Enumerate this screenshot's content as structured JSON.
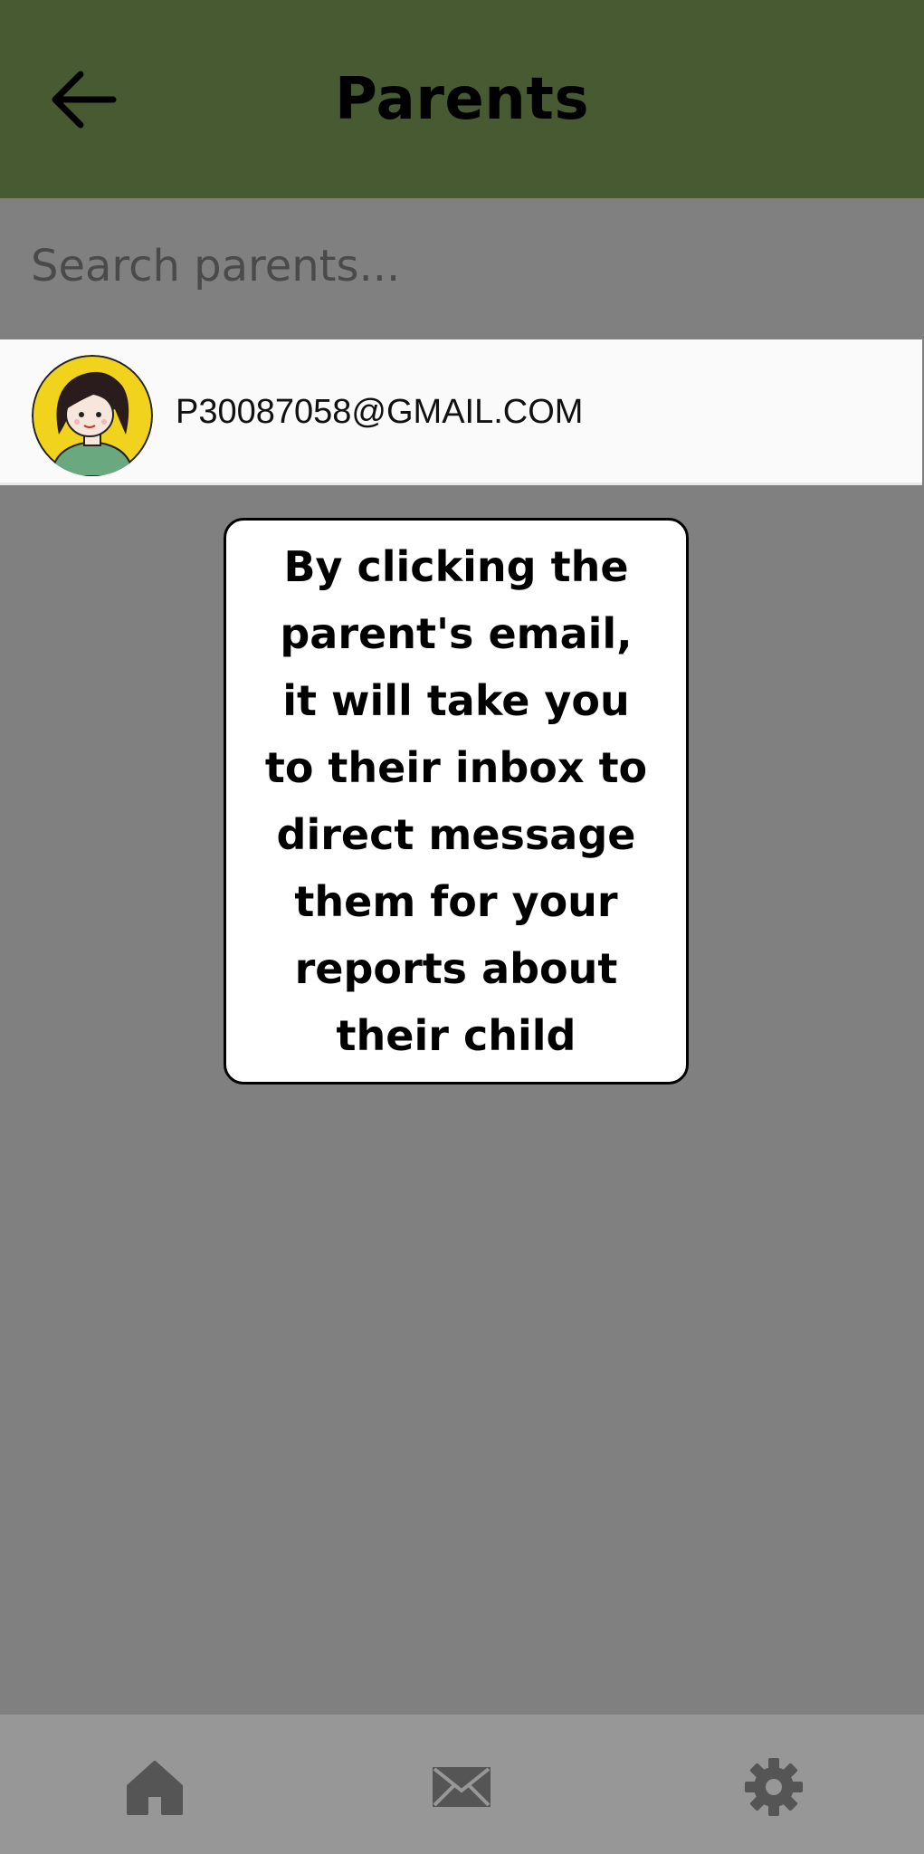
{
  "header": {
    "title": "Parents",
    "back_icon": "arrow-left-icon"
  },
  "search": {
    "placeholder": "Search parents..."
  },
  "parents": [
    {
      "email": "P30087058@GMAIL.COM",
      "avatar_icon": "avatar-icon"
    }
  ],
  "tooltip": {
    "text": "By clicking the parent's email, it will take you to their inbox to direct message them for your reports about their child"
  },
  "bottom_nav": {
    "items": [
      {
        "icon": "home-icon"
      },
      {
        "icon": "mail-icon"
      },
      {
        "icon": "gear-icon"
      }
    ]
  },
  "colors": {
    "app_bar": "#485a32",
    "overlay": "#808080",
    "bottom_nav": "#979797",
    "nav_icon": "#555555",
    "avatar_bg": "#f1d21d"
  }
}
